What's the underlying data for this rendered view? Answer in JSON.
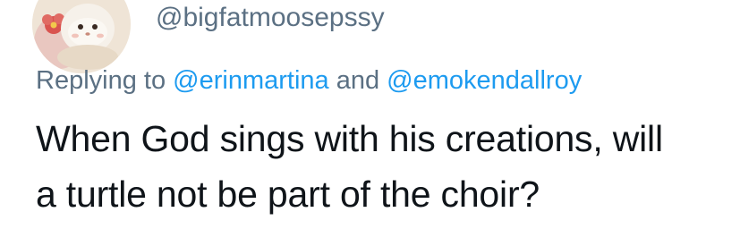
{
  "tweet": {
    "handle": "@bigfatmoosepssy",
    "reply": {
      "prefix": "Replying to",
      "mention_1": "@erinmartina",
      "conjunction": "and",
      "mention_2": "@emokendallroy"
    },
    "text_lines": [
      "When God sings with his creations, will",
      "a turtle not be part of the choir?"
    ]
  },
  "avatar": {
    "icon": "plush-toy-avatar-icon"
  },
  "colors": {
    "mention": "#1d9bf0",
    "secondary_text": "#5b7083",
    "primary_text": "#0f1419",
    "background": "#ffffff"
  }
}
